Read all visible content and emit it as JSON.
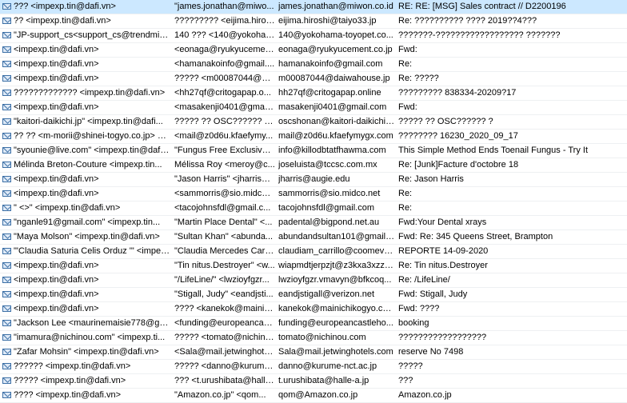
{
  "rows": [
    {
      "from": "??? <impexp.tin@dafi.vn>",
      "to": "\"james.jonathan@miwo...",
      "sender": "james.jonathan@miwon.co.id",
      "subject": "RE: RE: [MSG] Sales contract // D2200196",
      "selected": true
    },
    {
      "from": "?? <impexp.tin@dafi.vn>",
      "to": "????????? <eijima.hiroshi...",
      "sender": "eijima.hiroshi@taiyo33.jp",
      "subject": "Re: ?????????? ????  2019??4???",
      "selected": false
    },
    {
      "from": "\"JP-support_cs<support_cs@trendmicr...",
      "to": "140 ??? <140@yokoham...",
      "sender": "140@yokohama-toyopet.co...",
      "subject": "???????-?????????????????? ???????",
      "selected": false
    },
    {
      "from": "<impexp.tin@dafi.vn>",
      "to": "<eonaga@ryukyucement...",
      "sender": "eonaga@ryukyucement.co.jp",
      "subject": "Fwd:",
      "selected": false
    },
    {
      "from": "<impexp.tin@dafi.vn>",
      "to": "<hamanakoinfo@gmail....",
      "sender": "hamanakoinfo@gmail.com",
      "subject": "Re:",
      "selected": false
    },
    {
      "from": "<impexp.tin@dafi.vn>",
      "to": "????? <m00087044@dai...",
      "sender": "m00087044@daiwahouse.jp",
      "subject": "Re: ?????",
      "selected": false
    },
    {
      "from": "????????????? <impexp.tin@dafi.vn>",
      "to": "<hh27qf@critogapap.o...",
      "sender": "hh27qf@critogapap.online",
      "subject": "????????? 838334-20209?17",
      "selected": false
    },
    {
      "from": "<impexp.tin@dafi.vn>",
      "to": "<masakenji0401@gmail....",
      "sender": "masakenji0401@gmail.com",
      "subject": "Fwd:",
      "selected": false
    },
    {
      "from": "\"kaitori-daikichi.jp\" <impexp.tin@dafi...",
      "to": "????? ?? OSC?????? ? <os...",
      "sender": "oscshonan@kaitori-daikichi....",
      "subject": "????? ?? OSC?????? ?",
      "selected": false
    },
    {
      "from": "?? ?? <m-morii@shinei-togyo.co.jp> <i...",
      "to": "<mail@z0d6u.kfaefymy...",
      "sender": "mail@z0d6u.kfaefymygx.com",
      "subject": "???????? 16230_2020_09_17",
      "selected": false
    },
    {
      "from": "\"syounie@live.com\" <impexp.tin@dafi....",
      "to": "\"Fungus Free Exclusive ...",
      "sender": "info@killodbtatfhawma.com",
      "subject": "This Simple Method Ends Toenail Fungus - Try It",
      "selected": false
    },
    {
      "from": "Mélinda Breton-Couture <impexp.tin...",
      "to": "Mélissa Roy  <meroy@c...",
      "sender": "joseluista@tccsc.com.mx",
      "subject": "Re: [Junk]Facture d'octobre 18",
      "selected": false
    },
    {
      "from": "<impexp.tin@dafi.vn>",
      "to": "\"Jason Harris\" <jharris@...",
      "sender": "jharris@augie.edu",
      "subject": "Re: Jason Harris",
      "selected": false
    },
    {
      "from": "<impexp.tin@dafi.vn>",
      "to": "<sammorris@sio.midco....",
      "sender": "sammorris@sio.midco.net",
      "subject": "Re:",
      "selected": false
    },
    {
      "from": "\" <>\" <impexp.tin@dafi.vn>",
      "to": "<tacojohnsfdl@gmail.c...",
      "sender": "tacojohnsfdl@gmail.com",
      "subject": "Re:",
      "selected": false
    },
    {
      "from": "\"nganle91@gmail.com\" <impexp.tin...",
      "to": "\"Martin Place Dental\" <...",
      "sender": "padental@bigpond.net.au",
      "subject": "Fwd:Your Dental xrays",
      "selected": false
    },
    {
      "from": "\"Maya Molson\" <impexp.tin@dafi.vn>",
      "to": "\"Sultan Khan\" <abunda...",
      "sender": "abundandsultan101@gmail....",
      "subject": "Fwd: Re: 345 Queens Street, Brampton",
      "selected": false
    },
    {
      "from": "\"'Claudia Saturia Celis Orduz '\" <impex...",
      "to": "\"Claudia Mercedes Carri...",
      "sender": "claudiam_carrillo@coomeva...",
      "subject": "REPORTE 14-09-2020",
      "selected": false
    },
    {
      "from": "<impexp.tin@dafi.vn>",
      "to": "\"Tin nitus.Destroyer\" <w...",
      "sender": "wiapmdtjerpzjt@z3kxa3xzzs...",
      "subject": "Re: Tin nitus.Destroyer",
      "selected": false
    },
    {
      "from": "<impexp.tin@dafi.vn>",
      "to": "\"/LifeLine/\" <lwzioyfgzr...",
      "sender": "lwzioyfgzr.vmavyn@bfkcoq...",
      "subject": "Re: /LifeLine/",
      "selected": false
    },
    {
      "from": "<impexp.tin@dafi.vn>",
      "to": "\"Stigall, Judy\" <eandjsti...",
      "sender": "eandjstigall@verizon.net",
      "subject": "Fwd: Stigall, Judy",
      "selected": false
    },
    {
      "from": "<impexp.tin@dafi.vn>",
      "to": "???? <kanekok@mainich...",
      "sender": "kanekok@mainichikogyo.co....",
      "subject": "Fwd: ????",
      "selected": false
    },
    {
      "from": "\"Jackson Lee <maurinemaisie778@gm...",
      "to": "<funding@europeancas...",
      "sender": "funding@europeancastleho...",
      "subject": "booking",
      "selected": false
    },
    {
      "from": "\"imamura@nichinou.com\" <impexp.ti...",
      "to": "????? <tomato@nichino...",
      "sender": "tomato@nichinou.com",
      "subject": "??????????????????",
      "selected": false
    },
    {
      "from": "\"Zafar Mohsin\" <impexp.tin@dafi.vn>",
      "to": "<Sala@mail.jetwinghote...",
      "sender": "Sala@mail.jetwinghotels.com",
      "subject": "reserve No 7498",
      "selected": false
    },
    {
      "from": "?????? <impexp.tin@dafi.vn>",
      "to": "????? <danno@kurume-...",
      "sender": "danno@kurume-nct.ac.jp",
      "subject": "?????",
      "selected": false
    },
    {
      "from": "????? <impexp.tin@dafi.vn>",
      "to": "??? <t.urushibata@halle...",
      "sender": "t.urushibata@halle-a.jp",
      "subject": "???",
      "selected": false
    },
    {
      "from": "???? <impexp.tin@dafi.vn>",
      "to": "\"Amazon.co.jp\" <qom...",
      "sender": "qom@Amazon.co.jp",
      "subject": "Amazon.co.jp",
      "selected": false
    }
  ],
  "icons": {
    "row_icon": "envelope-icon"
  },
  "colors": {
    "selected_row": "#cce8ff",
    "icon_stroke": "#3a6ea5"
  }
}
